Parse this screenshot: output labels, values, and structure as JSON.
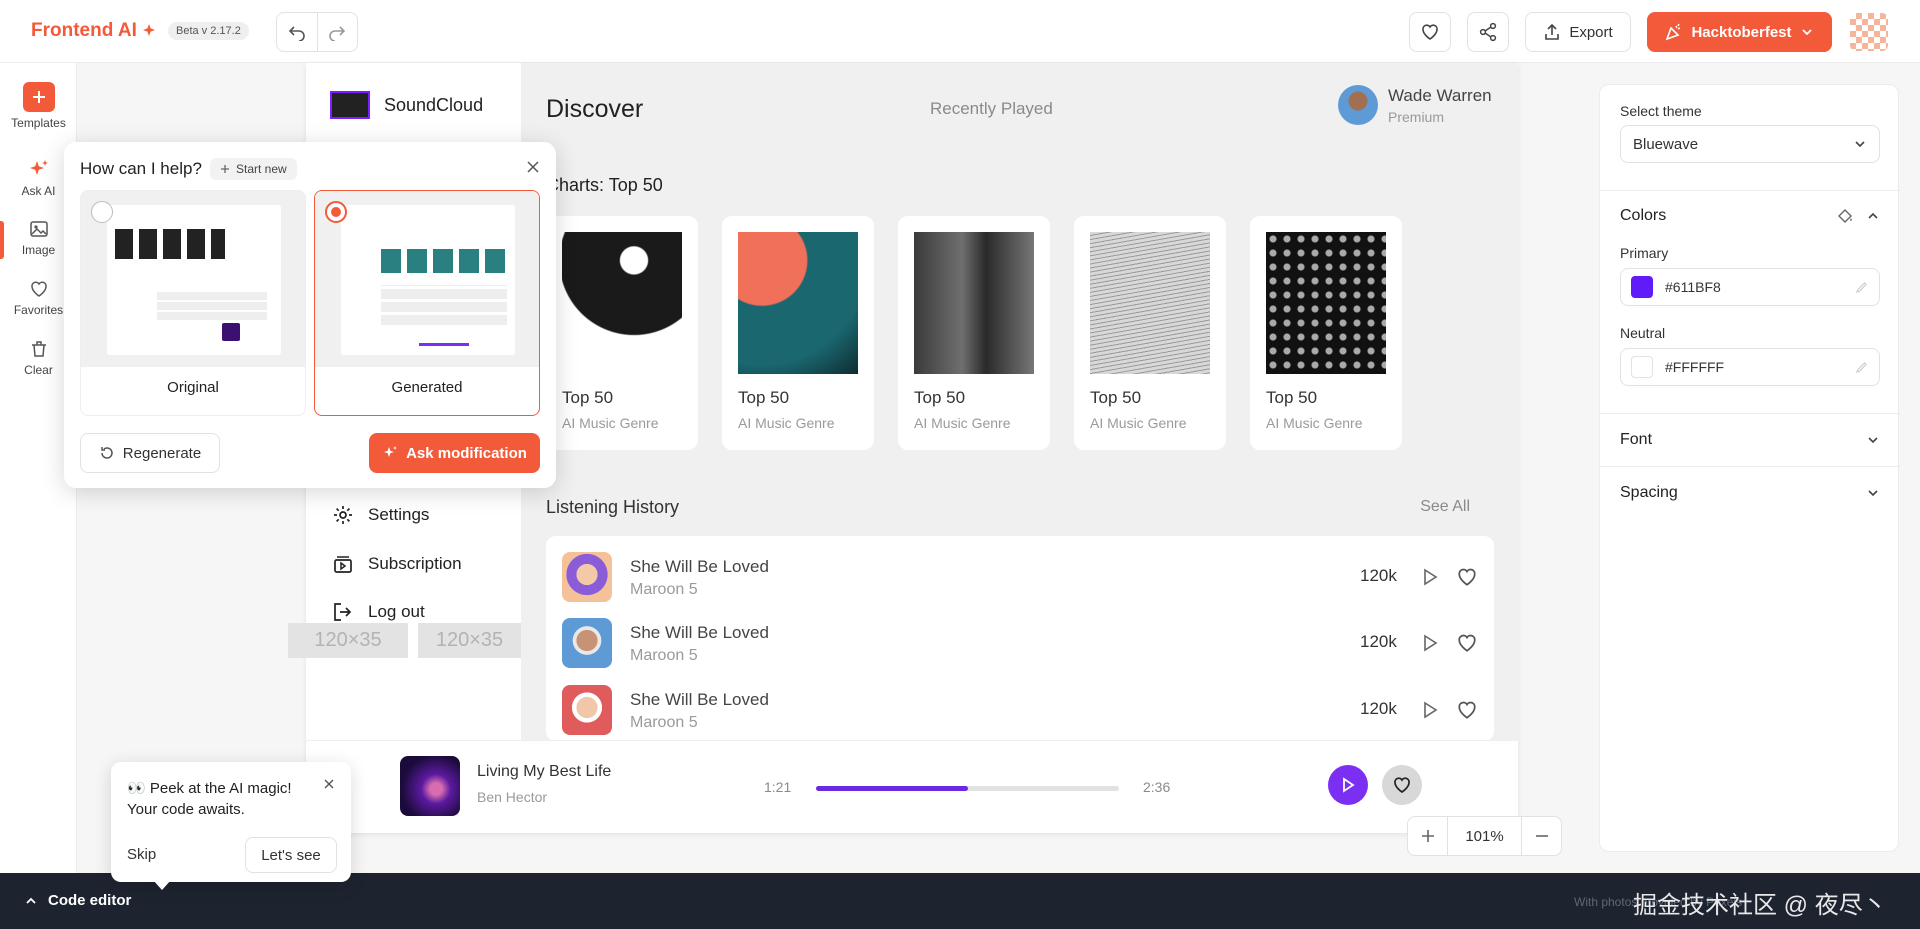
{
  "topbar": {
    "brand": "Frontend AI",
    "version": "Beta v 2.17.2",
    "export_label": "Export",
    "hacktoberfest_label": "Hacktoberfest",
    "brand_color": "#F25A3A"
  },
  "leftrail": {
    "items": [
      {
        "label": "Templates",
        "icon": "plus-icon"
      },
      {
        "label": "Ask AI",
        "icon": "sparkle-icon",
        "active": true
      },
      {
        "label": "Image",
        "icon": "image-icon"
      },
      {
        "label": "Favorites",
        "icon": "heart-icon"
      },
      {
        "label": "Clear",
        "icon": "trash-icon"
      }
    ]
  },
  "soundcloud": {
    "brand": "SoundCloud",
    "menu": [
      {
        "label": "Settings",
        "icon": "gear-icon"
      },
      {
        "label": "Subscription",
        "icon": "subscription-icon"
      },
      {
        "label": "Log out",
        "icon": "logout-icon"
      }
    ],
    "placeholders": [
      "120×35",
      "120×35"
    ],
    "discover": "Discover",
    "recently_played": "Recently Played",
    "user": {
      "name": "Wade Warren",
      "plan": "Premium"
    },
    "charts_title": "Charts: Top 50",
    "cards": [
      {
        "title": "Top 50",
        "subtitle": "AI Music Genre"
      },
      {
        "title": "Top 50",
        "subtitle": "AI Music Genre"
      },
      {
        "title": "Top 50",
        "subtitle": "AI Music Genre"
      },
      {
        "title": "Top 50",
        "subtitle": "AI Music Genre"
      },
      {
        "title": "Top 50",
        "subtitle": "AI Music Genre"
      }
    ],
    "history_title": "Listening History",
    "see_all": "See All",
    "history": [
      {
        "title": "She Will Be Loved",
        "artist": "Maroon 5",
        "plays": "120k"
      },
      {
        "title": "She Will Be Loved",
        "artist": "Maroon 5",
        "plays": "120k"
      },
      {
        "title": "She Will Be Loved",
        "artist": "Maroon 5",
        "plays": "120k"
      }
    ],
    "player": {
      "title": "Living My Best Life",
      "artist": "Ben Hector",
      "current": "1:21",
      "duration": "2:36",
      "progress": 0.5
    }
  },
  "zoom": {
    "value": "101%"
  },
  "theme_panel": {
    "select_label": "Select theme",
    "selected_theme": "Bluewave",
    "colors_label": "Colors",
    "primary_label": "Primary",
    "primary_value": "#611BF8",
    "neutral_label": "Neutral",
    "neutral_value": "#FFFFFF",
    "font_label": "Font",
    "spacing_label": "Spacing"
  },
  "ai_popup": {
    "title": "How can I help?",
    "start_new": "Start new",
    "options": [
      {
        "label": "Original",
        "selected": false
      },
      {
        "label": "Generated",
        "selected": true
      }
    ],
    "regenerate": "Regenerate",
    "ask_modification": "Ask modification"
  },
  "tooltip": {
    "text": "👀 Peek at the AI magic! Your code awaits.",
    "skip": "Skip",
    "lets_see": "Let's see"
  },
  "bottombar": {
    "code_editor": "Code editor",
    "credit": "With photos provided by Pexels",
    "watermark": "掘金技术社区 @ 夜尽丶"
  }
}
